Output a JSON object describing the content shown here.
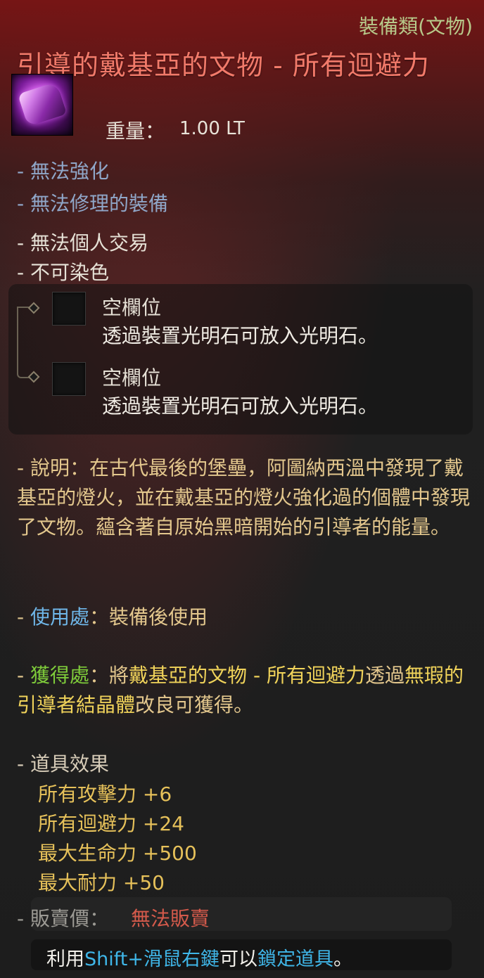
{
  "item": {
    "category": "裝備類(文物)",
    "name": "引導的戴基亞的文物 - 所有迴避力",
    "icon": "pink-relic-gem-icon",
    "weight_label": "重量：",
    "weight_value": "1.00 LT"
  },
  "properties": [
    "- 無法強化",
    "- 無法修理的裝備",
    "- 無法個人交易",
    "- 不可染色"
  ],
  "slots": [
    {
      "title": "空欄位",
      "description": "透過裝置光明石可放入光明石。"
    },
    {
      "title": "空欄位",
      "description": "透過裝置光明石可放入光明石。"
    }
  ],
  "description": {
    "text": "- 說明：在古代最後的堡壘，阿圖納西溫中發現了戴基亞的燈火，並在戴基亞的燈火強化過的個體中發現了文物。蘊含著自原始黑暗開始的引導者的能量。"
  },
  "usage": {
    "prefix": "- ",
    "label": "使用處",
    "separator": "：",
    "value": "裝備後使用"
  },
  "obtain": {
    "prefix": "- ",
    "label": "獲得處",
    "separator": "：將",
    "item_ref": "戴基亞的文物 - 所有迴避力",
    "middle": "透過",
    "material_ref": "無瑕的引導者結晶體",
    "suffix": "改良可獲得。"
  },
  "effects": {
    "heading": "- 道具效果",
    "items": [
      "所有攻擊力 +6",
      "所有迴避力 +24",
      "最大生命力 +500",
      "最大耐力 +50"
    ]
  },
  "price": {
    "label": "- 販賣價：",
    "value": "無法販賣"
  },
  "lock_hint": {
    "pre": "利用",
    "key": "Shift+滑鼠右鍵",
    "mid": "可以",
    "action": "鎖定道具",
    "end": "。"
  },
  "colors": {
    "title": "#f27a6a",
    "category": "#b7c98a",
    "description": "#e3c78d",
    "usage_label": "#6fb6e8",
    "obtain_label": "#7ecb3a",
    "effects": "#e6c15a",
    "price_value": "#d45a4b",
    "lock_highlight": "#3fb6e8"
  }
}
